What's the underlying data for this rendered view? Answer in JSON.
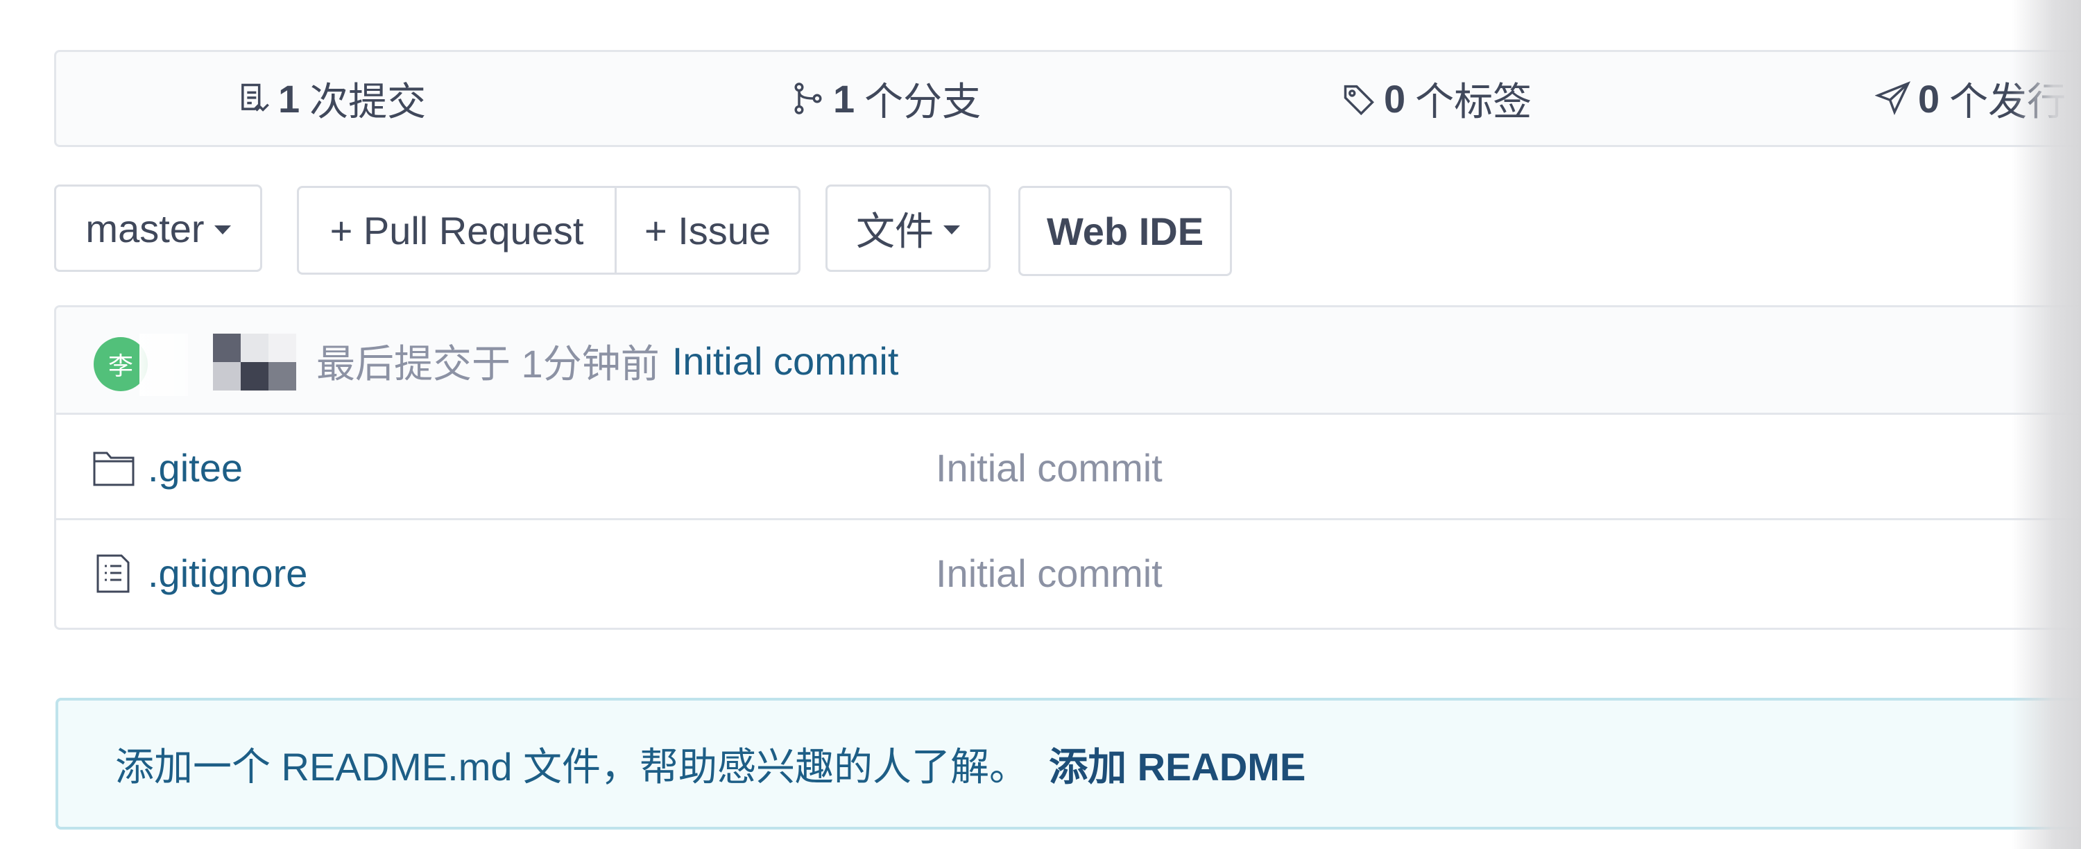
{
  "stats": {
    "commits": {
      "count": "1",
      "label": "次提交",
      "icon": "commit-file-icon"
    },
    "branches": {
      "count": "1",
      "label": "个分支",
      "icon": "branch-icon"
    },
    "tags": {
      "count": "0",
      "label": "个标签",
      "icon": "tag-icon"
    },
    "releases": {
      "count": "0",
      "label": "个发行",
      "icon": "send-icon"
    }
  },
  "toolbar": {
    "branch_label": "master",
    "pull_request_label": "+ Pull Request",
    "issue_label": "+ Issue",
    "file_label": "文件",
    "web_ide_label": "Web IDE"
  },
  "commit": {
    "avatar_initial": "李",
    "meta_text": "最后提交于 1分钟前",
    "message": "Initial commit"
  },
  "files": [
    {
      "name": ".gitee",
      "type": "folder",
      "commit_message": "Initial commit"
    },
    {
      "name": ".gitignore",
      "type": "file",
      "commit_message": "Initial commit"
    }
  ],
  "readme_notice": {
    "text": "添加一个 README.md 文件，帮助感兴趣的人了解。",
    "link_label": "添加 README"
  },
  "colors": {
    "link": "#1d5e86",
    "muted": "#8c92a4",
    "text": "#40485b",
    "avatar_bg": "#52c07a",
    "notice_bg": "#f2fbfc",
    "notice_border": "#bfe3ec"
  }
}
